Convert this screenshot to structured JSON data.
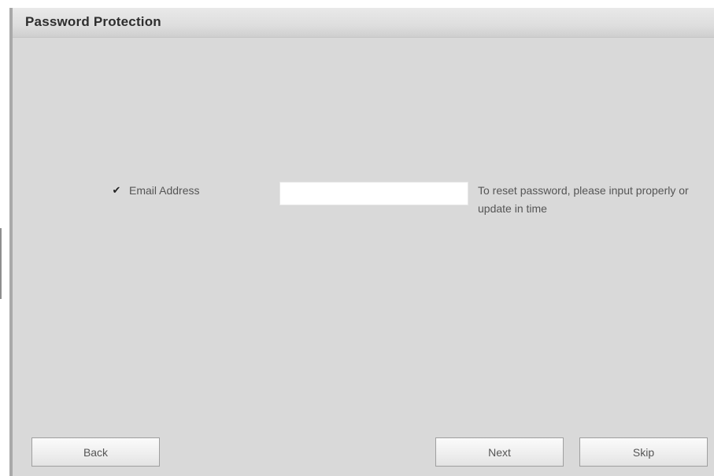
{
  "dialog": {
    "title": "Password Protection"
  },
  "form": {
    "email": {
      "checked": true,
      "checkbox_glyph": "✔",
      "label": "Email Address",
      "value": "",
      "placeholder": ""
    },
    "hint": "To reset password, please input properly or update in time"
  },
  "footer": {
    "back_label": "Back",
    "next_label": "Next",
    "skip_label": "Skip"
  },
  "colors": {
    "panel_background": "#d9d9d9",
    "title_text": "#2e2e2e",
    "label_text": "#555555",
    "input_background": "#ffffff"
  }
}
